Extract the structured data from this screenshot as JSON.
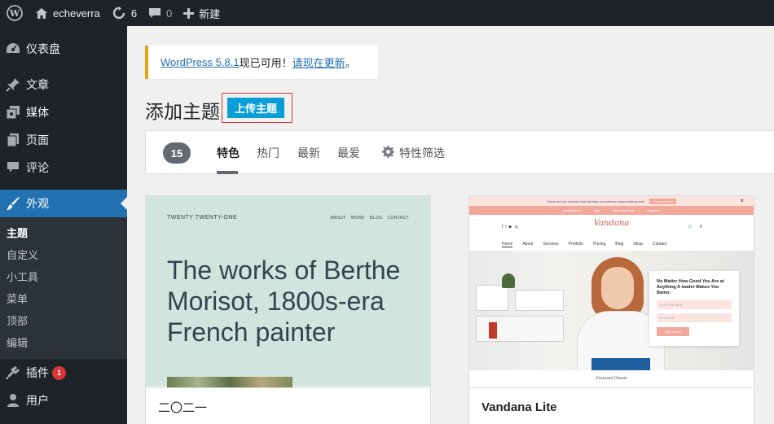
{
  "adminbar": {
    "site_name": "echeverra",
    "updates_count": "6",
    "comments_count": "0",
    "new_label": "新建"
  },
  "sidebar": {
    "items": [
      {
        "label": "仪表盘",
        "icon": "dashboard-icon"
      },
      {
        "label": "文章",
        "icon": "pin-icon"
      },
      {
        "label": "媒体",
        "icon": "media-icon"
      },
      {
        "label": "页面",
        "icon": "page-icon"
      },
      {
        "label": "评论",
        "icon": "comment-icon"
      },
      {
        "label": "外观",
        "icon": "brush-icon"
      }
    ],
    "submenu": [
      "主题",
      "自定义",
      "小工具",
      "菜单",
      "顶部",
      "编辑"
    ],
    "plugins": {
      "label": "插件",
      "badge": "1"
    },
    "users": {
      "label": "用户"
    }
  },
  "notice": {
    "link1": "WordPress 5.8.1",
    "middle": "现已可用！",
    "link2": "请现在更新",
    "end": "。"
  },
  "page": {
    "title": "添加主题",
    "upload_button": "上传主题"
  },
  "filter": {
    "count": "15",
    "tabs": [
      "特色",
      "热门",
      "最新",
      "最爱"
    ],
    "feature_filter": "特性筛选"
  },
  "themes": [
    {
      "name": "二〇二一",
      "preview": {
        "brand": "TWENTY TWENTY-ONE",
        "nav": [
          "ABOUT",
          "WORK",
          "BLOG",
          "CONTACT"
        ],
        "headline": "The works of Berthe Morisot, 1800s-era French painter"
      }
    },
    {
      "name": "Vandana Lite",
      "preview": {
        "topbar_text": "Check out our services that will help you witness exponential growth",
        "topbar_pill": "Purchase now",
        "pink_links": [
          "Accessories",
          "Spa",
          "New Year Sale",
          "Payment"
        ],
        "logo": "Vandana",
        "nav": [
          "Home",
          "About",
          "Services",
          "Portfolio",
          "Pricing",
          "Blog",
          "Shop",
          "Contact"
        ],
        "form_title": "No Matter How Good You Are at Anything A leader Makes You Better.",
        "field1": "Your First Name",
        "field2": "Your Email",
        "submit": "Sign me up!",
        "bottom": "Featured Clients"
      }
    }
  ]
}
